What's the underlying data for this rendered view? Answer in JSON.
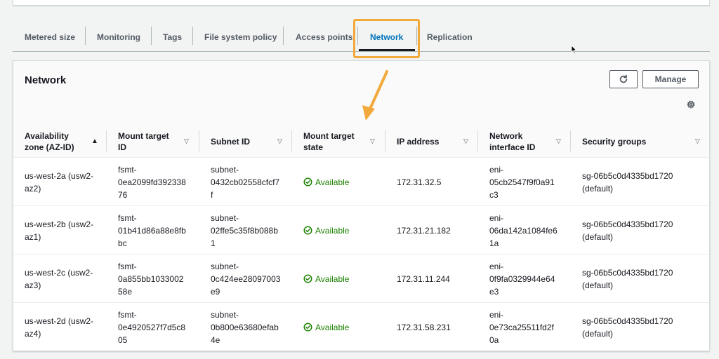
{
  "tabs": [
    {
      "label": "Metered size"
    },
    {
      "label": "Monitoring"
    },
    {
      "label": "Tags"
    },
    {
      "label": "File system policy"
    },
    {
      "label": "Access points"
    },
    {
      "label": "Network"
    },
    {
      "label": "Replication"
    }
  ],
  "active_tab": "Network",
  "panel": {
    "title": "Network",
    "manage_label": "Manage"
  },
  "columns": [
    {
      "line1": "Availability",
      "line2": "zone (AZ-ID)"
    },
    {
      "line1": "Mount target",
      "line2": "ID"
    },
    {
      "line1": "Subnet ID",
      "line2": ""
    },
    {
      "line1": "Mount target",
      "line2": "state"
    },
    {
      "line1": "IP address",
      "line2": ""
    },
    {
      "line1": "Network",
      "line2": "interface ID"
    },
    {
      "line1": "Security groups",
      "line2": ""
    }
  ],
  "rows": [
    {
      "az": [
        "us-west-2a (usw2-",
        "az2)"
      ],
      "mount_target_id": [
        "fsmt-",
        "0ea2099fd392338",
        "76"
      ],
      "subnet_id": [
        "subnet-",
        "0432cb02558cfcf7",
        "f"
      ],
      "state": "Available",
      "ip": "172.31.32.5",
      "eni": [
        "eni-",
        "05cb2547f9f0a91",
        "c3"
      ],
      "sg": [
        "sg-06b5c0d4335bd1720",
        "(default)"
      ]
    },
    {
      "az": [
        "us-west-2b (usw2-",
        "az1)"
      ],
      "mount_target_id": [
        "fsmt-",
        "01b41d86a88e8fb",
        "bc"
      ],
      "subnet_id": [
        "subnet-",
        "02ffe5c35f8b088b",
        "1"
      ],
      "state": "Available",
      "ip": "172.31.21.182",
      "eni": [
        "eni-",
        "06da142a1084fe6",
        "1a"
      ],
      "sg": [
        "sg-06b5c0d4335bd1720",
        "(default)"
      ]
    },
    {
      "az": [
        "us-west-2c (usw2-",
        "az3)"
      ],
      "mount_target_id": [
        "fsmt-",
        "0a855bb1033002",
        "58e"
      ],
      "subnet_id": [
        "subnet-",
        "0c424ee28097003",
        "e9"
      ],
      "state": "Available",
      "ip": "172.31.11.244",
      "eni": [
        "eni-",
        "0f9fa0329944e64",
        "e3"
      ],
      "sg": [
        "sg-06b5c0d4335bd1720",
        "(default)"
      ]
    },
    {
      "az": [
        "us-west-2d (usw2-",
        "az4)"
      ],
      "mount_target_id": [
        "fsmt-",
        "0e4920527f7d5c8",
        "05"
      ],
      "subnet_id": [
        "subnet-",
        "0b800e63680efab",
        "4e"
      ],
      "state": "Available",
      "ip": "172.31.58.231",
      "eni": [
        "eni-",
        "0e73ca25511fd2f",
        "0a"
      ],
      "sg": [
        "sg-06b5c0d4335bd1720",
        "(default)"
      ]
    }
  ],
  "icons": {
    "refresh": "refresh-icon",
    "settings": "gear-icon",
    "status_ok": "check-circle-icon",
    "sort_asc": "sort-ascending-icon",
    "sort": "sort-caret-down-icon"
  },
  "colors": {
    "highlight": "#f2a93b",
    "active_tab": "#0073bb",
    "status_ok": "#1d8102"
  }
}
